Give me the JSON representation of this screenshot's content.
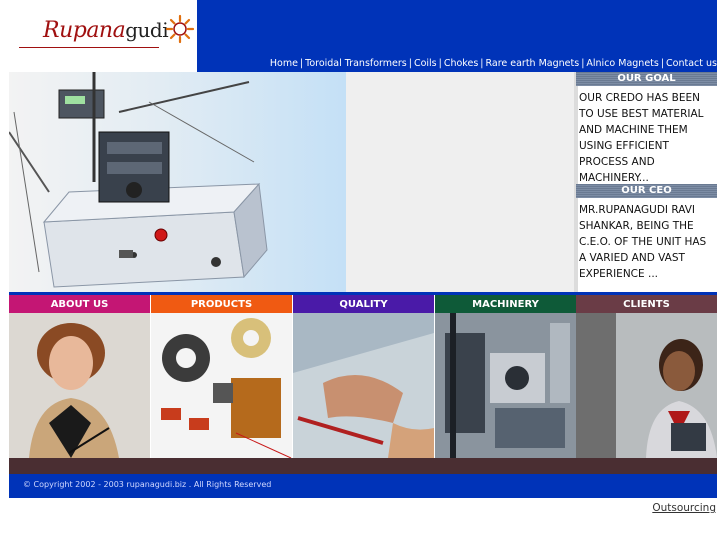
{
  "logo": {
    "script_text": "Rupana",
    "plain_text": "gudi",
    "sun_icon": "sun-logo-icon"
  },
  "nav": {
    "items": [
      "Home",
      "Toroidal Transformers",
      "Coils",
      "Chokes",
      "Rare earth Magnets",
      "Alnico Magnets",
      "Contact us"
    ],
    "separator": "|"
  },
  "side": {
    "goal_title": "OUR GOAL",
    "goal_text": "OUR CREDO HAS BEEN TO USE BEST MATERIAL AND MACHINE THEM USING EFFICIENT PROCESS AND MACHINERY...",
    "ceo_title": "OUR CEO",
    "ceo_text": "MR.RUPANAGUDI RAVI SHANKAR, BEING THE C.E.O. OF THE UNIT HAS A VARIED AND VAST EXPERIENCE ..."
  },
  "categories": [
    {
      "label": "ABOUT US",
      "color": "#c41674"
    },
    {
      "label": "PRODUCTS",
      "color": "#f05a12"
    },
    {
      "label": "QUALITY",
      "color": "#4a1aa8"
    },
    {
      "label": "MACHINERY",
      "color": "#0e5a38"
    },
    {
      "label": "CLIENTS",
      "color": "#6a3c46"
    }
  ],
  "colors": {
    "brand_blue": "#0033b8",
    "dark_band": "#4a2e32"
  },
  "footer": {
    "copyright": "© Copyright 2002 - 2003 rupanagudi.biz . All Rights Reserved"
  },
  "outsourcing_link": "Outsourcing"
}
